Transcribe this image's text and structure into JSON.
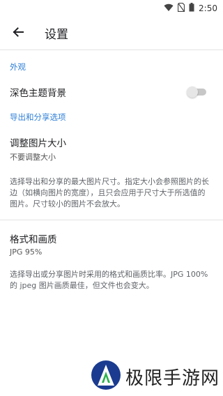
{
  "status_bar": {
    "time": "2:50"
  },
  "app_bar": {
    "title": "设置"
  },
  "sections": [
    {
      "header": "外观"
    },
    {
      "header": "导出和分享选项"
    }
  ],
  "dark_theme": {
    "label": "深色主题背景",
    "enabled": false
  },
  "resize": {
    "label": "调整图片大小",
    "value": "不要调整大小",
    "description": "选择导出和分享的最大图片尺寸。指定大小会参照图片的长边（如横向图片的宽度），且只会应用于尺寸大于所选值的图片。尺寸较小的图片不会放大。"
  },
  "format": {
    "label": "格式和画质",
    "value": "JPG 95%",
    "description": "选择导出或分享图片时采用的格式和画质比率。JPG 100% 的 jpeg 图片画质最佳，但文件也会变大。"
  },
  "watermark": {
    "text": "极限手游网"
  }
}
